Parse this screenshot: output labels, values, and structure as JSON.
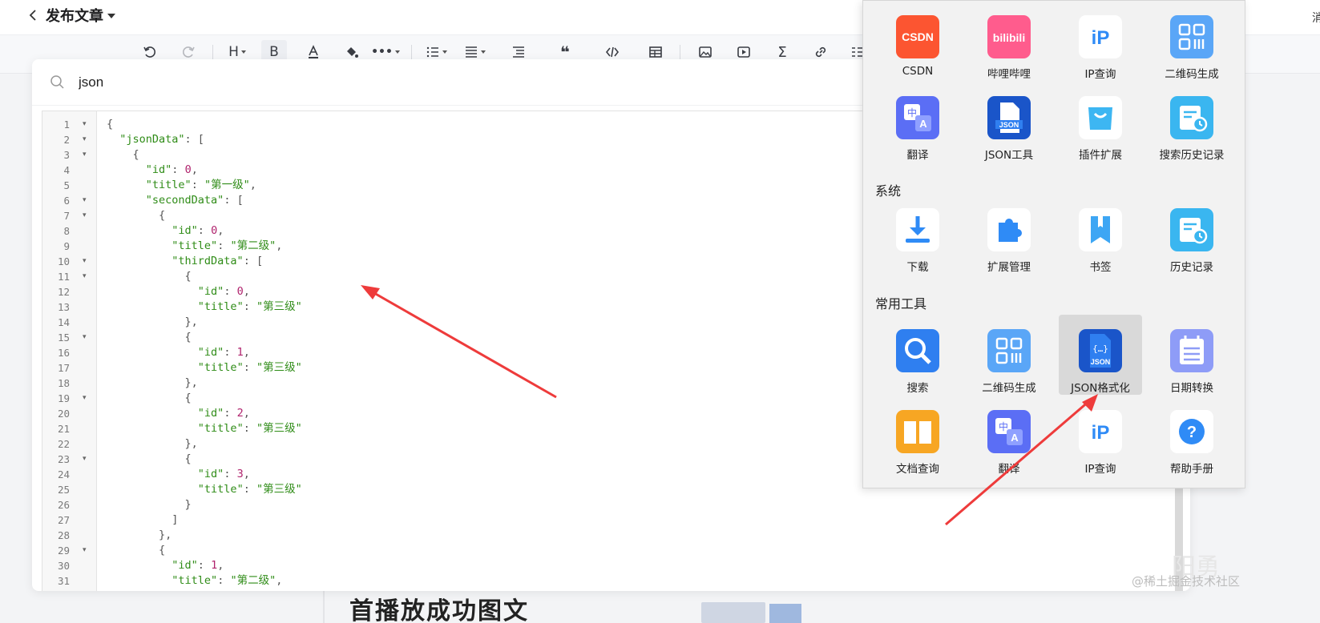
{
  "header": {
    "back_icon": "chevron-left-icon",
    "title": "发布文章",
    "edge_text": "消"
  },
  "toolbar": {
    "items": [
      "undo-icon",
      "redo-icon",
      "heading-icon",
      "bold-icon",
      "font-color-icon",
      "fill-color-icon",
      "more-icon",
      "list-icon",
      "align-icon",
      "indent-icon",
      "quote-icon",
      "code-icon",
      "table-icon",
      "image-icon",
      "video-icon",
      "formula-icon",
      "link-icon",
      "task-list-icon"
    ]
  },
  "search": {
    "value": "json",
    "placeholder": ""
  },
  "editor": {
    "lines": [
      {
        "n": "1",
        "fold": true
      },
      {
        "n": "2",
        "fold": true
      },
      {
        "n": "3",
        "fold": true
      },
      {
        "n": "4",
        "fold": false
      },
      {
        "n": "5",
        "fold": false
      },
      {
        "n": "6",
        "fold": true
      },
      {
        "n": "7",
        "fold": true
      },
      {
        "n": "8",
        "fold": false
      },
      {
        "n": "9",
        "fold": false
      },
      {
        "n": "10",
        "fold": true
      },
      {
        "n": "11",
        "fold": true
      },
      {
        "n": "12",
        "fold": false
      },
      {
        "n": "13",
        "fold": false
      },
      {
        "n": "14",
        "fold": false
      },
      {
        "n": "15",
        "fold": true
      },
      {
        "n": "16",
        "fold": false
      },
      {
        "n": "17",
        "fold": false
      },
      {
        "n": "18",
        "fold": false
      },
      {
        "n": "19",
        "fold": true
      },
      {
        "n": "20",
        "fold": false
      },
      {
        "n": "21",
        "fold": false
      },
      {
        "n": "22",
        "fold": false
      },
      {
        "n": "23",
        "fold": true
      },
      {
        "n": "24",
        "fold": false
      },
      {
        "n": "25",
        "fold": false
      },
      {
        "n": "26",
        "fold": false
      },
      {
        "n": "27",
        "fold": false
      },
      {
        "n": "28",
        "fold": false
      },
      {
        "n": "29",
        "fold": true
      },
      {
        "n": "30",
        "fold": false
      },
      {
        "n": "31",
        "fold": false
      }
    ],
    "keys": {
      "jsonData": "\"jsonData\"",
      "id": "\"id\"",
      "title": "\"title\"",
      "secondData": "\"secondData\"",
      "thirdData": "\"thirdData\""
    },
    "values": {
      "l1": "第一级",
      "l2": "第二级",
      "l3": "第三级",
      "n0": "0",
      "n1": "1",
      "n2": "2",
      "n3": "3"
    }
  },
  "panel": {
    "apps": [
      {
        "label": "CSDN",
        "icon": "csdn-icon"
      },
      {
        "label": "哔哩哔哩",
        "icon": "bilibili-icon"
      },
      {
        "label": "IP查询",
        "icon": "ip-icon"
      },
      {
        "label": "二维码生成",
        "icon": "qrcode-icon"
      },
      {
        "label": "翻译",
        "icon": "translate-icon"
      },
      {
        "label": "JSON工具",
        "icon": "json-file-icon"
      },
      {
        "label": "插件扩展",
        "icon": "shopping-bag-icon"
      },
      {
        "label": "搜索历史记录",
        "icon": "history-icon"
      }
    ],
    "system_label": "系统",
    "system": [
      {
        "label": "下载",
        "icon": "download-icon"
      },
      {
        "label": "扩展管理",
        "icon": "puzzle-icon"
      },
      {
        "label": "书签",
        "icon": "bookmark-icon"
      },
      {
        "label": "历史记录",
        "icon": "history-icon"
      }
    ],
    "tools_label": "常用工具",
    "tools": [
      {
        "label": "搜索",
        "icon": "search-icon"
      },
      {
        "label": "二维码生成",
        "icon": "qrcode-icon"
      },
      {
        "label": "JSON格式化",
        "icon": "json-format-icon",
        "active": true
      },
      {
        "label": "日期转换",
        "icon": "calendar-icon"
      },
      {
        "label": "文档查询",
        "icon": "book-icon"
      },
      {
        "label": "翻译",
        "icon": "translate-icon"
      },
      {
        "label": "IP查询",
        "icon": "ip-icon"
      },
      {
        "label": "帮助手册",
        "icon": "help-icon"
      }
    ]
  },
  "bottom": {
    "clipped_heading": "首播放成功图文",
    "watermark": "@稀土掘金技术社区",
    "watermark_big": "阳勇"
  },
  "colors": {
    "accent_arrow": "#ee3b3b",
    "json_key": "#2f8c17",
    "json_number": "#b0236d"
  }
}
